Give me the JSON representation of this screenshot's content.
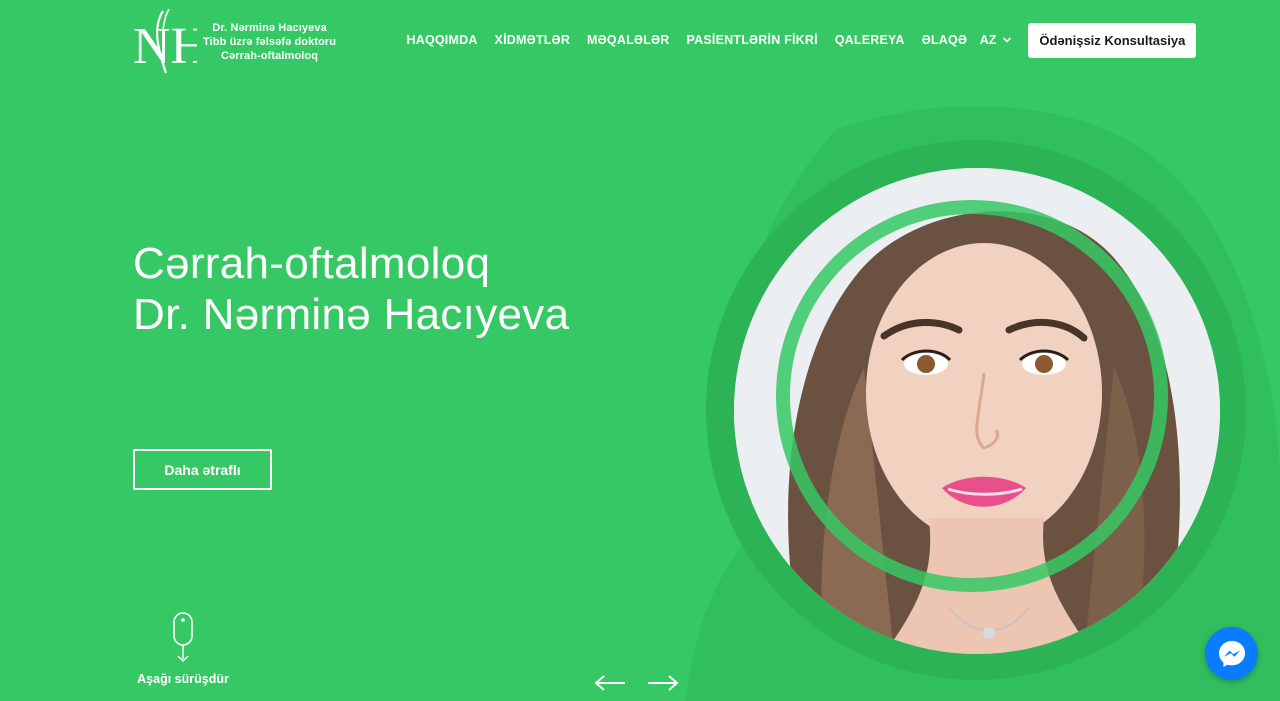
{
  "brand": {
    "monogram": "NH",
    "name": "Dr. Nərminə Hacıyeva",
    "degree": "Tibb üzrə fəlsəfə doktoru",
    "specialty": "Cərrah-oftalmoloq"
  },
  "nav": {
    "items": [
      {
        "label": "HAQQIMDA"
      },
      {
        "label": "XİDMƏTLƏR"
      },
      {
        "label": "MƏQALƏLƏR"
      },
      {
        "label": "PASİENTLƏRİN FİKRİ"
      },
      {
        "label": "QALEREYA"
      },
      {
        "label": "ƏLAQƏ"
      }
    ],
    "language": "AZ",
    "cta_label": "Ödənişsiz Konsultasiya"
  },
  "hero": {
    "title_line1": "Cərrah-oftalmoloq",
    "title_line2": "Dr. Nərminə Hacıyeva",
    "more_button": "Daha ətraflı",
    "scroll_label": "Aşağı sürüşdür"
  },
  "colors": {
    "background": "#36c864",
    "ring": "#2bb356",
    "messenger": "#0a7cff",
    "text": "#ffffff"
  },
  "icons": {
    "slider_prev": "arrow-left-icon",
    "slider_next": "arrow-right-icon",
    "language": "chevron-down-icon",
    "scroll": "mouse-icon",
    "chat": "messenger-icon"
  }
}
